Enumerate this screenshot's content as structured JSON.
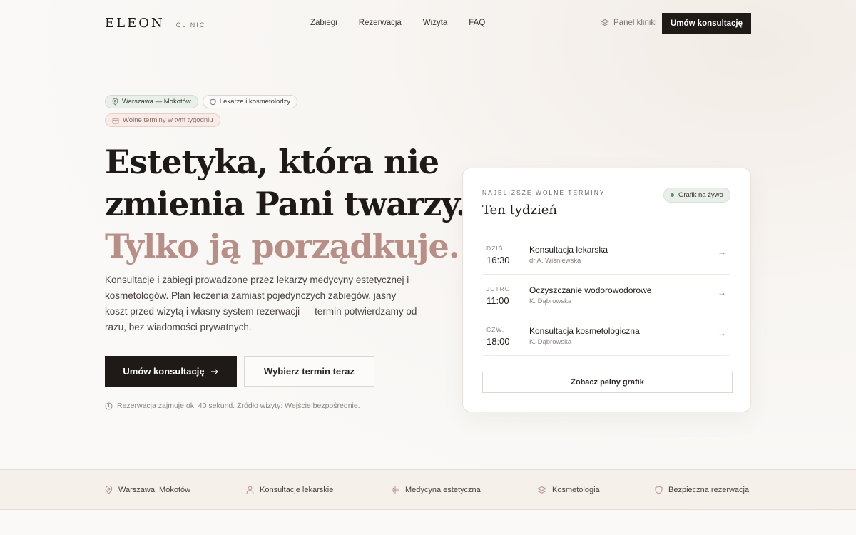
{
  "brand": {
    "name": "ELEON",
    "sub": "CLINIC"
  },
  "nav": {
    "items": [
      {
        "label": "Zabiegi"
      },
      {
        "label": "Rezerwacja"
      },
      {
        "label": "Wizyta"
      },
      {
        "label": "FAQ"
      }
    ]
  },
  "header": {
    "panel_label": "Panel kliniki",
    "cta_label": "Umów konsultację"
  },
  "chips": {
    "location": "Warszawa — Mokotów",
    "staff": "Lekarze i kosmetolodzy",
    "availability": "Wolne terminy w tym tygodniu"
  },
  "hero": {
    "line1": "Estetyka, która nie",
    "line2": "zmienia Pani twarzy.",
    "line3": "Tylko ją porządkuje.",
    "lede": "Konsultacje i zabiegi prowadzone przez lekarzy medycyny estetycznej i kosmetologów. Plan leczenia zamiast pojedynczych zabiegów, jasny koszt przed wizytą i własny system rezerwacji — termin potwierdzamy od razu, bez wiadomości prywatnych.",
    "primary_label": "Umów konsultację",
    "secondary_label": "Wybierz termin teraz",
    "note": "Rezerwacja zajmuje ok. 40 sekund. Źródło wizyty: Wejście bezpośrednie."
  },
  "card": {
    "kicker": "NAJBLIŻSZE WOLNE TERMINY",
    "title": "Ten tydzień",
    "badge": "Grafik na żywo",
    "slots": [
      {
        "day": "DZIŚ",
        "time": "16:30",
        "name": "Konsultacja lekarska",
        "person": "dr A. Wiśniewska"
      },
      {
        "day": "JUTRO",
        "time": "11:00",
        "name": "Oczyszczanie wodorowodorowe",
        "person": "K. Dąbrowska"
      },
      {
        "day": "CZW.",
        "time": "18:00",
        "name": "Konsultacja kosmetologiczna",
        "person": "K. Dąbrowska"
      }
    ],
    "button_label": "Zobacz pełny grafik"
  },
  "strip": {
    "items": [
      {
        "label": "Warszawa, Mokotów",
        "icon": "map-pin-icon"
      },
      {
        "label": "Konsultacje lekarskie",
        "icon": "user-icon"
      },
      {
        "label": "Medycyna estetyczna",
        "icon": "sparkle-icon"
      },
      {
        "label": "Kosmetologia",
        "icon": "layers-icon"
      },
      {
        "label": "Bezpieczna rezerwacja",
        "icon": "shield-icon"
      }
    ]
  },
  "colors": {
    "accent": "#b88f86",
    "dark": "#1f1a18",
    "live": "#5d8c6b"
  }
}
